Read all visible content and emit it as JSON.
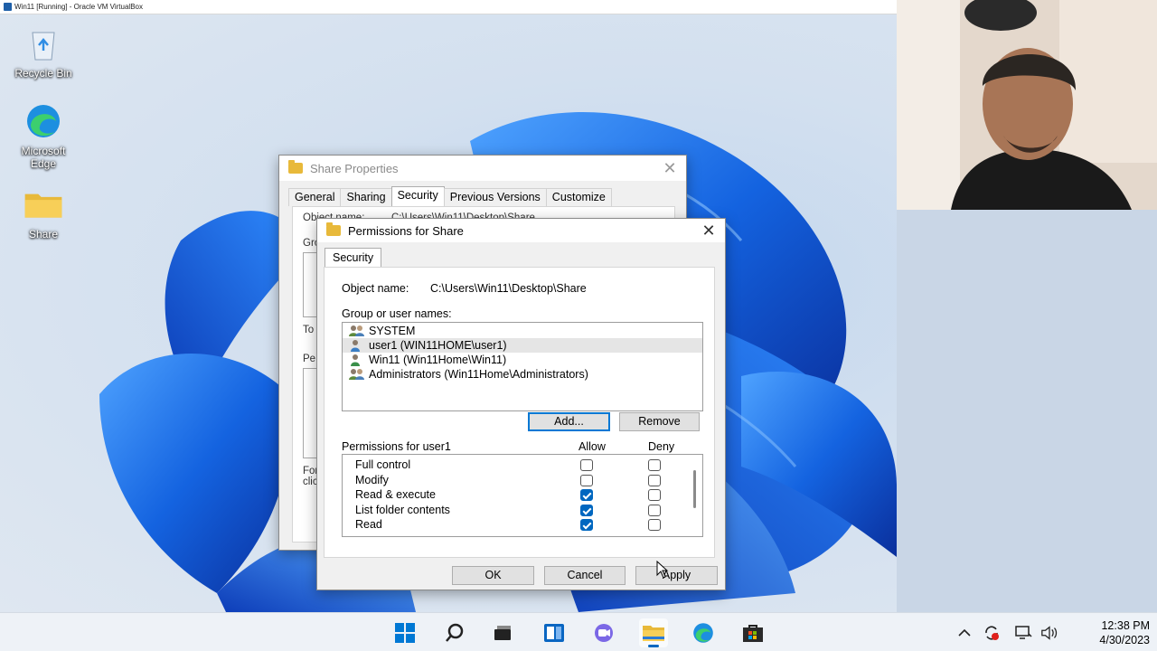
{
  "vbox": {
    "title": "Win11 [Running] - Oracle VM VirtualBox"
  },
  "desktop": {
    "icons": [
      {
        "label": "Recycle Bin",
        "icon": "recycle-bin-icon"
      },
      {
        "label": "Microsoft Edge",
        "icon": "edge-icon"
      },
      {
        "label": "Share",
        "icon": "folder-icon"
      }
    ]
  },
  "share_properties": {
    "title": "Share Properties",
    "tabs": [
      "General",
      "Sharing",
      "Security",
      "Previous Versions",
      "Customize"
    ],
    "active_tab": "Security",
    "frag_object": "Object name:",
    "frag_object_value": "C:\\Users\\Win11\\Desktop\\Share",
    "frag_group": "Gro",
    "frag_to": "To",
    "frag_perm": "Pe",
    "frag_for": "For",
    "frag_click": "clic"
  },
  "permissions_dialog": {
    "title": "Permissions for Share",
    "tab": "Security",
    "object_label": "Object name:",
    "object_value": "C:\\Users\\Win11\\Desktop\\Share",
    "group_label": "Group or user names:",
    "users": [
      {
        "name": "SYSTEM",
        "icon": "user-group-icon",
        "selected": false
      },
      {
        "name": "user1 (WIN11HOME\\user1)",
        "icon": "user-icon",
        "selected": true
      },
      {
        "name": "Win11 (Win11Home\\Win11)",
        "icon": "user-icon",
        "selected": false
      },
      {
        "name": "Administrators (Win11Home\\Administrators)",
        "icon": "user-group-icon",
        "selected": false
      }
    ],
    "add_label": "Add...",
    "remove_label": "Remove",
    "permissions_for_label": "Permissions for user1",
    "allow_label": "Allow",
    "deny_label": "Deny",
    "permissions": [
      {
        "name": "Full control",
        "allow": false,
        "deny": false
      },
      {
        "name": "Modify",
        "allow": false,
        "deny": false
      },
      {
        "name": "Read & execute",
        "allow": true,
        "deny": false
      },
      {
        "name": "List folder contents",
        "allow": true,
        "deny": false
      },
      {
        "name": "Read",
        "allow": true,
        "deny": false
      }
    ],
    "ok_label": "OK",
    "cancel_label": "Cancel",
    "apply_label": "Apply"
  },
  "taskbar": {
    "icons": [
      "start-icon",
      "search-icon",
      "task-view-icon",
      "widgets-icon",
      "chat-icon",
      "file-explorer-icon",
      "edge-icon",
      "store-icon"
    ],
    "active": "file-explorer-icon",
    "tray": [
      "chevron-up-icon",
      "sync-icon",
      "network-icon",
      "volume-icon"
    ],
    "time": "12:38 PM",
    "date": "4/30/2023"
  },
  "colors": {
    "accent": "#0067c0",
    "folder": "#e8b93a",
    "wallpaper_blue": "#1a5fd9"
  }
}
